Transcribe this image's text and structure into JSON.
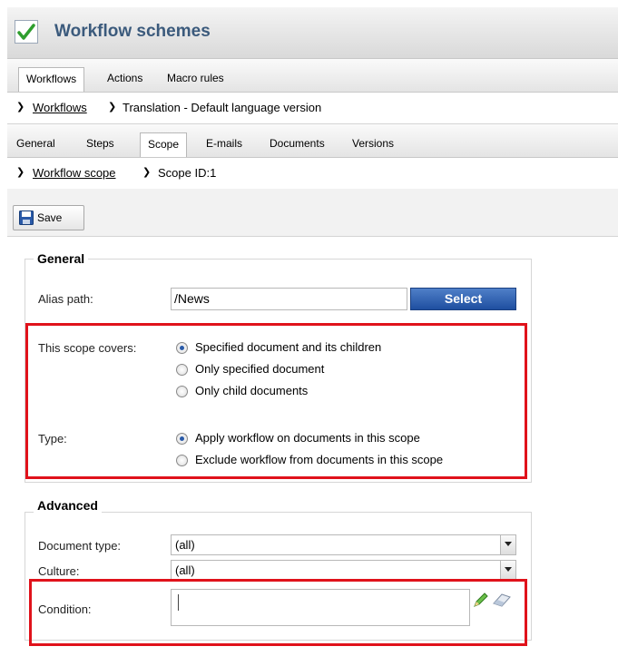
{
  "header": {
    "title": "Workflow schemes",
    "icon": "check-icon"
  },
  "main_tabs": [
    {
      "label": "Workflows",
      "active": true
    },
    {
      "label": "Actions",
      "active": false
    },
    {
      "label": "Macro rules",
      "active": false
    }
  ],
  "breadcrumb1": {
    "link": "Workflows",
    "current": "Translation - Default language version"
  },
  "sub_tabs": [
    {
      "label": "General",
      "active": false
    },
    {
      "label": "Steps",
      "active": false
    },
    {
      "label": "Scope",
      "active": true
    },
    {
      "label": "E-mails",
      "active": false
    },
    {
      "label": "Documents",
      "active": false
    },
    {
      "label": "Versions",
      "active": false
    }
  ],
  "breadcrumb2": {
    "link": "Workflow scope",
    "current": "Scope ID:1"
  },
  "toolbar": {
    "save_label": "Save"
  },
  "general": {
    "legend": "General",
    "alias_label": "Alias path:",
    "alias_value": "/News",
    "select_label": "Select",
    "covers_label": "This scope covers:",
    "covers_options": [
      {
        "label": "Specified document and its children",
        "checked": true
      },
      {
        "label": "Only specified document",
        "checked": false
      },
      {
        "label": "Only child documents",
        "checked": false
      }
    ],
    "type_label": "Type:",
    "type_options": [
      {
        "label": "Apply workflow on documents in this scope",
        "checked": true
      },
      {
        "label": "Exclude workflow from documents in this scope",
        "checked": false
      }
    ]
  },
  "advanced": {
    "legend": "Advanced",
    "doctype_label": "Document type:",
    "doctype_value": "(all)",
    "culture_label": "Culture:",
    "culture_value": "(all)",
    "condition_label": "Condition:",
    "condition_value": ""
  },
  "colors": {
    "highlight": "#e0121b",
    "title": "#3b5a7c",
    "select_button": "#2a5aa8"
  }
}
